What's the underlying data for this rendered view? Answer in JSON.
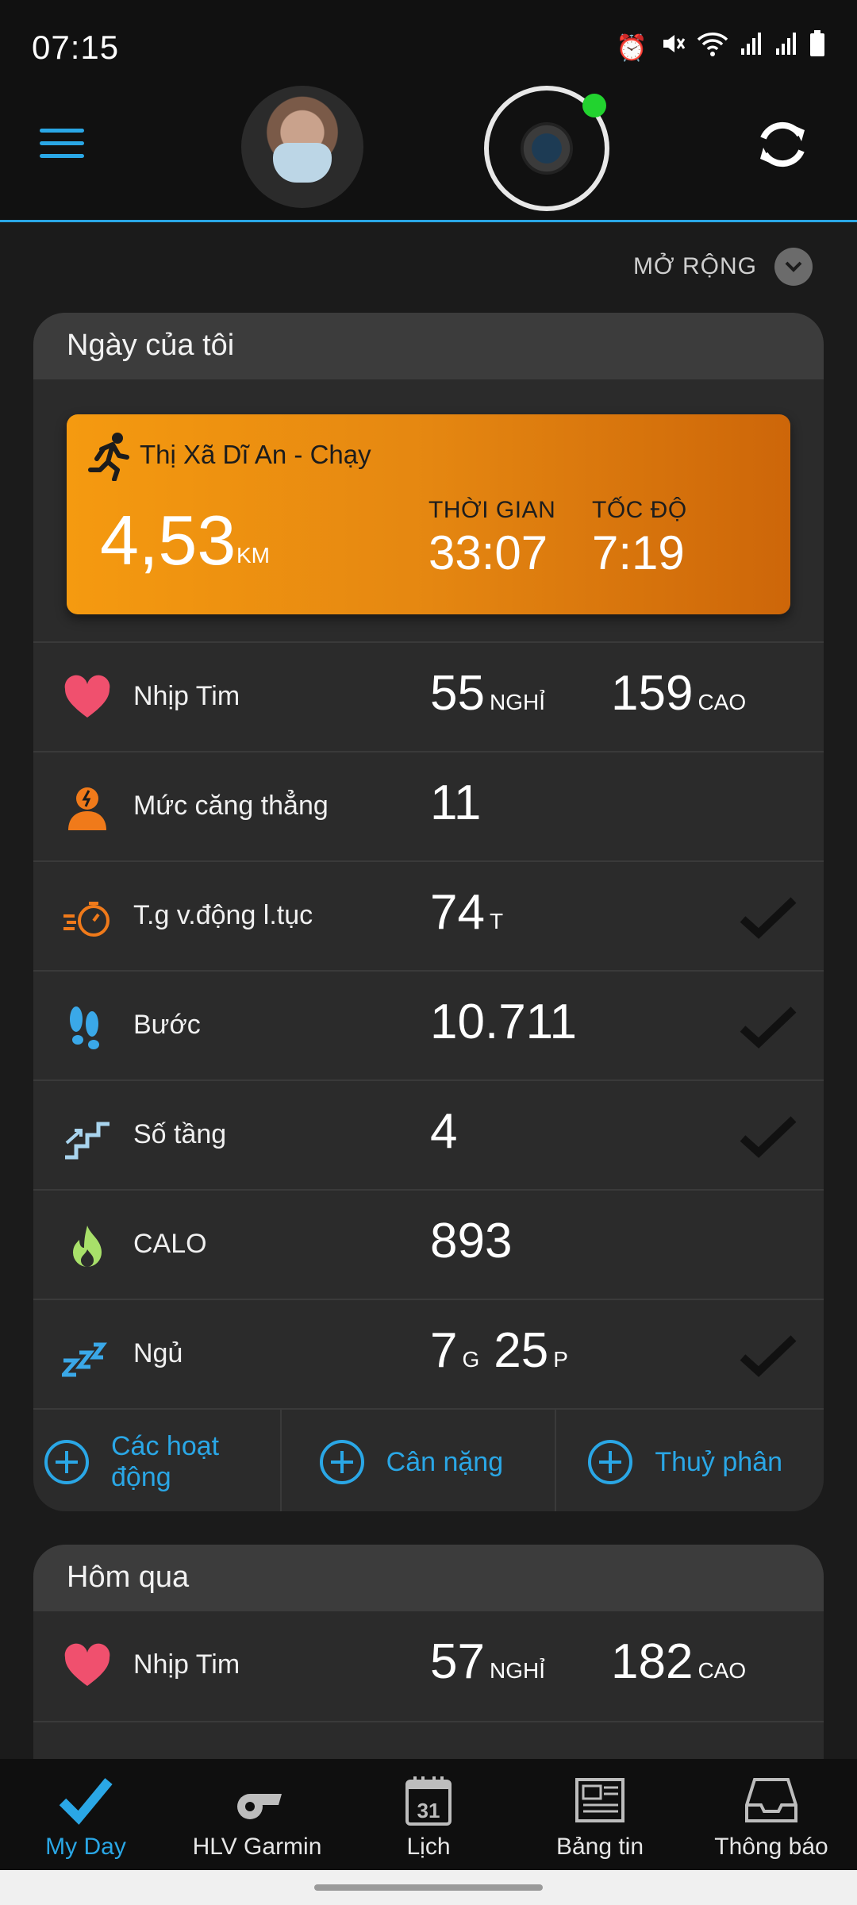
{
  "status": {
    "time": "07:15",
    "icons": [
      "alarm-icon",
      "mute-icon",
      "wifi-icon",
      "signal-icon",
      "signal-icon",
      "battery-icon"
    ]
  },
  "header": {
    "menu_icon": "hamburger-icon",
    "sync_icon": "sync-icon",
    "device_connected_color": "#22d32f"
  },
  "expand": {
    "label": "MỞ RỘNG"
  },
  "today": {
    "title": "Ngày của tôi",
    "activity": {
      "name": "Thị Xã Dĩ An - Chạy",
      "distance": "4,53",
      "distance_unit": "KM",
      "time_label": "THỜI GIAN",
      "time_value": "33:07",
      "pace_label": "TỐC ĐỘ",
      "pace_value": "7:19"
    },
    "rows": [
      {
        "label": "Nhịp Tim",
        "value": "55",
        "unit": "NGHỈ",
        "value2": "159",
        "unit2": "CAO"
      },
      {
        "label": "Mức căng thẳng",
        "value": "11"
      },
      {
        "label": "T.g v.động l.tục",
        "value": "74",
        "unit": "T"
      },
      {
        "label": "Bước",
        "value": "10.711"
      },
      {
        "label": "Số tầng",
        "value": "4"
      },
      {
        "label": "CALO",
        "value": "893"
      },
      {
        "label": "Ngủ",
        "value": "7",
        "unit": "G",
        "value2": "25",
        "unit2": "P"
      }
    ],
    "actions": [
      "Các hoạt động",
      "Cân nặng",
      "Thuỷ phân"
    ]
  },
  "yesterday": {
    "title": "Hôm qua",
    "rows": [
      {
        "label": "Nhịp Tim",
        "value": "57",
        "unit": "NGHỈ",
        "value2": "182",
        "unit2": "CAO"
      }
    ]
  },
  "nav": [
    {
      "label": "My Day",
      "icon": "check-icon",
      "active": true
    },
    {
      "label": "HLV Garmin",
      "icon": "whistle-icon"
    },
    {
      "label": "Lịch",
      "icon": "calendar-icon",
      "calendar_day": "31"
    },
    {
      "label": "Bảng tin",
      "icon": "newspaper-icon"
    },
    {
      "label": "Thông báo",
      "icon": "inbox-icon"
    }
  ],
  "colors": {
    "accent": "#2aa7e6",
    "activity_orange": "#e58711",
    "heart": "#f0506e",
    "stress": "#f07a1a",
    "steps": "#3aa8e8",
    "calories": "#a8e06a"
  }
}
